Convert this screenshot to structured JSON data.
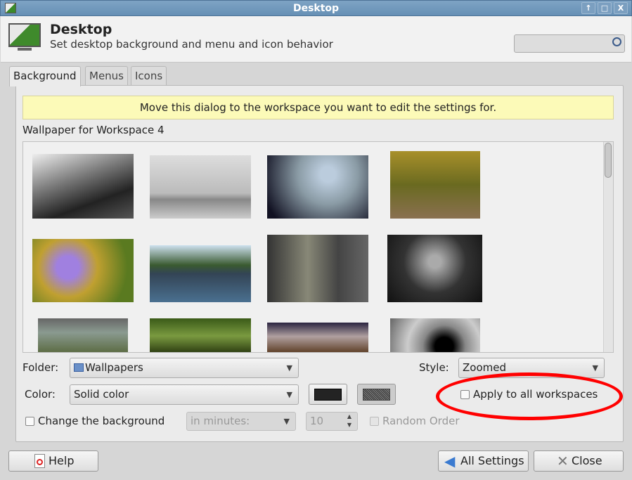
{
  "window": {
    "title": "Desktop",
    "buttons": [
      "↑",
      "□",
      "X"
    ]
  },
  "header": {
    "title": "Desktop",
    "subtitle": "Set desktop background and menu and icon behavior",
    "search_placeholder": ""
  },
  "tabs": [
    {
      "label": "Background",
      "active": true
    },
    {
      "label": "Menus"
    },
    {
      "label": "Icons"
    }
  ],
  "banner": "Move this dialog to the workspace you want to edit the settings for.",
  "wallpaper_label": "Wallpaper for Workspace 4",
  "thumbnails": [
    "black-white car photo",
    "frosted trees",
    "water drop",
    "autumn forest path",
    "purple flower",
    "lake reflection",
    "industrial corridor",
    "woman portrait",
    "graffiti sky",
    "mossy tree",
    "sunset landscape",
    "spiral staircase"
  ],
  "folder": {
    "label": "Folder:",
    "value": "Wallpapers"
  },
  "style": {
    "label": "Style:",
    "value": "Zoomed"
  },
  "color": {
    "label": "Color:",
    "value": "Solid color",
    "primary": "#232323",
    "secondary": "#555555"
  },
  "apply_all": {
    "label": "Apply to all workspaces",
    "checked": false
  },
  "change_bg": {
    "label": "Change the background",
    "checked": false,
    "interval": "in minutes:",
    "value": "10"
  },
  "random": {
    "label": "Random Order",
    "checked": false
  },
  "buttons": {
    "help": "Help",
    "all_settings": "All Settings",
    "close": "Close"
  },
  "annotation_color": "#ff0000"
}
